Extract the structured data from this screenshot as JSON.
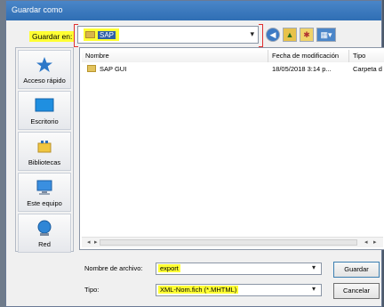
{
  "window": {
    "title": "Guardar como"
  },
  "header": {
    "save_in_label": "Guardar en:",
    "current_folder": "SAP"
  },
  "toolbar": {
    "icons": [
      "back-icon",
      "up-folder-icon",
      "new-folder-icon",
      "view-menu-icon"
    ]
  },
  "places": [
    {
      "label": "Acceso rápido",
      "icon": "star-icon"
    },
    {
      "label": "Escritorio",
      "icon": "desktop-icon"
    },
    {
      "label": "Bibliotecas",
      "icon": "libraries-icon"
    },
    {
      "label": "Este equipo",
      "icon": "computer-icon"
    },
    {
      "label": "Red",
      "icon": "network-icon"
    }
  ],
  "file_list": {
    "columns": [
      "Nombre",
      "Fecha de modificación",
      "Tipo"
    ],
    "rows": [
      {
        "name": "SAP GUI",
        "date": "18/05/2018 3:14 p...",
        "type": "Carpeta d"
      }
    ]
  },
  "form": {
    "filename_label": "Nombre de archivo:",
    "filename_value": "export",
    "type_label": "Tipo:",
    "type_value": "XML-Nom.fich (*.MHTML)"
  },
  "buttons": {
    "save": "Guardar",
    "cancel": "Cancelar"
  },
  "colors": {
    "highlight": "#ffff33",
    "title_bar": "#3a7bc0",
    "accent_bracket": "#e03030"
  }
}
